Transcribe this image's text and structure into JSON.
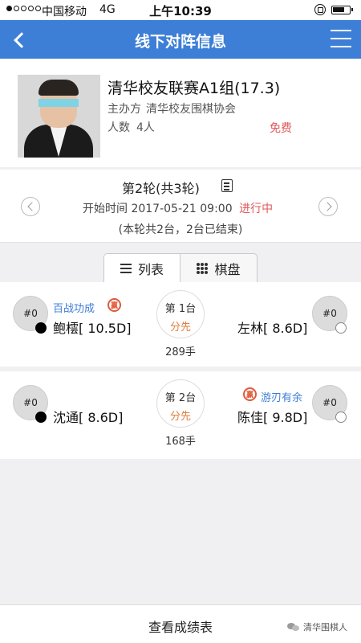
{
  "status_bar": {
    "carrier": "中国移动",
    "network": "4G",
    "time": "上午10:39"
  },
  "nav": {
    "title": "线下对阵信息"
  },
  "event": {
    "title": "清华校友联赛A1组(17.3)",
    "organizer_label": "主办方",
    "organizer": "清华校友围棋协会",
    "headcount_label": "人数",
    "headcount": "4人",
    "fee": "免费"
  },
  "round": {
    "title": "第2轮(共3轮)",
    "start_label": "开始时间",
    "start_time": "2017-05-21 09:00",
    "status": "进行中",
    "summary": "(本轮共2台，2台已结束)"
  },
  "tabs": [
    {
      "label": "列表",
      "icon": "list-icon",
      "active": true
    },
    {
      "label": "棋盘",
      "icon": "board-icon",
      "active": false
    }
  ],
  "games": [
    {
      "board": "第 1台",
      "first_move": "分先",
      "moves": "289手",
      "left": {
        "rank": "#0",
        "name": "鲍橒[ 10.5D]",
        "tag": "百战功成",
        "stone": "black"
      },
      "right": {
        "rank": "#0",
        "name": "左林[ 8.6D]",
        "tag": "",
        "stone": "white"
      }
    },
    {
      "board": "第 2台",
      "first_move": "分先",
      "moves": "168手",
      "left": {
        "rank": "#0",
        "name": "沈通[ 8.6D]",
        "tag": "",
        "stone": "black"
      },
      "right": {
        "rank": "#0",
        "name": "陈佳[ 9.8D]",
        "tag": "游刃有余",
        "stone": "white"
      }
    }
  ],
  "seal_text": "赢",
  "bottom": {
    "scores_button": "查看成绩表"
  },
  "watermark": "清华围棋人",
  "colors": {
    "nav": "#3d7fd6",
    "accent_red": "#e05a5a",
    "tag_blue": "#3d7fd6"
  }
}
